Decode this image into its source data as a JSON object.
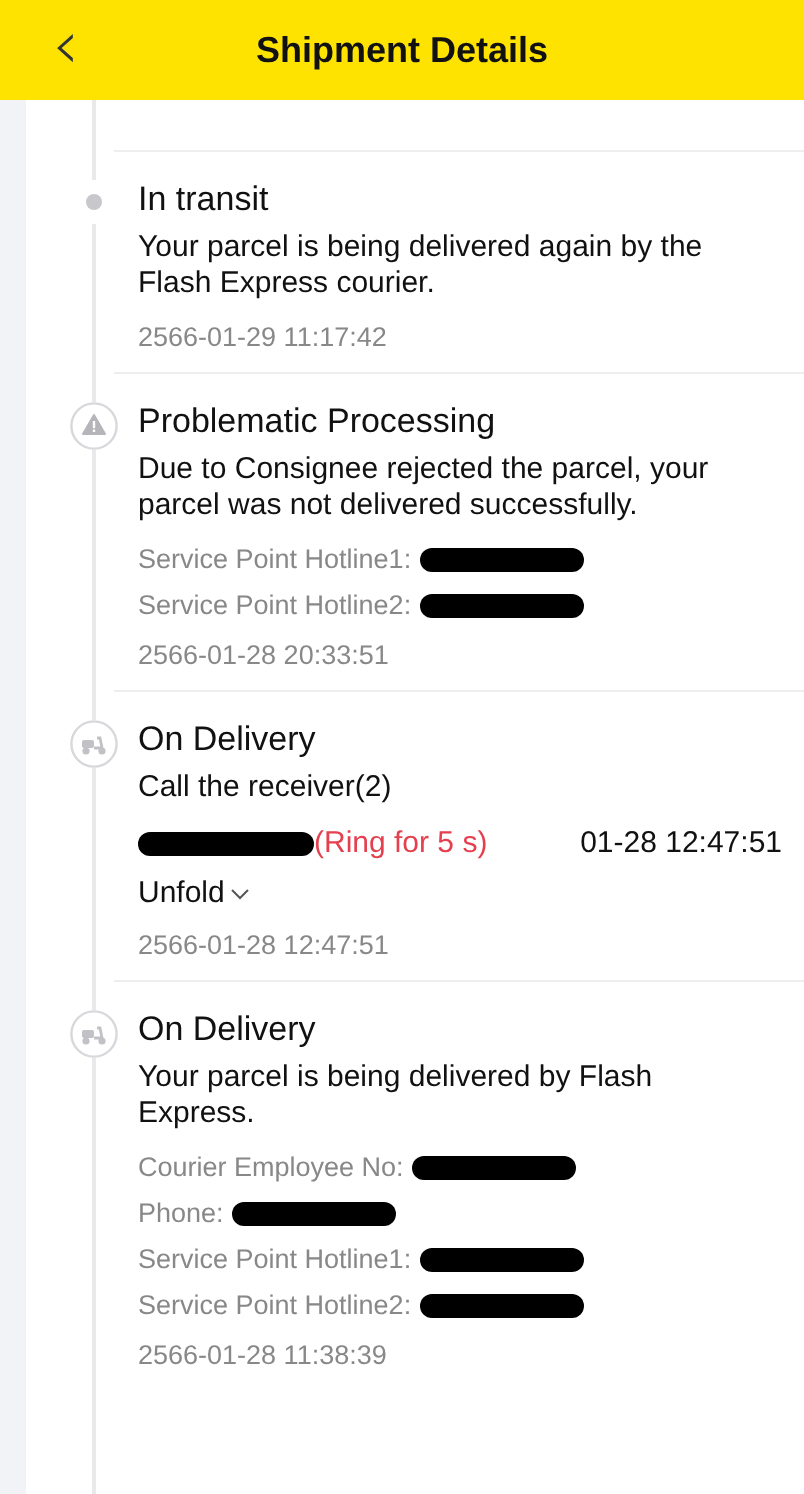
{
  "header": {
    "title": "Shipment Details",
    "back_icon": "‹"
  },
  "events": [
    {
      "kind": "dot",
      "title": "In transit",
      "description": "Your parcel is being delivered again by the Flash Express courier.",
      "time": "2566-01-29 11:17:42"
    },
    {
      "kind": "warning",
      "title": "Problematic Processing",
      "description": "Due to Consignee rejected the parcel, your parcel was not delivered successfully.",
      "details": [
        {
          "label": "Service Point Hotline1:",
          "redacted": true
        },
        {
          "label": "Service Point Hotline2:",
          "redacted": true
        }
      ],
      "time": "2566-01-28 20:33:51"
    },
    {
      "kind": "scooter",
      "title": "On Delivery",
      "description": "Call the receiver(2)",
      "call": {
        "redacted": true,
        "status": "(Ring for 5 s)",
        "call_time": "01-28 12:47:51"
      },
      "unfold": "Unfold",
      "time": "2566-01-28 12:47:51"
    },
    {
      "kind": "scooter",
      "title": "On Delivery",
      "description": "Your parcel is being delivered by Flash Express.",
      "details": [
        {
          "label": "Courier Employee No:",
          "redacted": true
        },
        {
          "label": "Phone:",
          "redacted": true
        },
        {
          "label": "Service Point Hotline1:",
          "redacted": true
        },
        {
          "label": "Service Point Hotline2:",
          "redacted": true
        }
      ],
      "time": "2566-01-28 11:38:39"
    }
  ]
}
